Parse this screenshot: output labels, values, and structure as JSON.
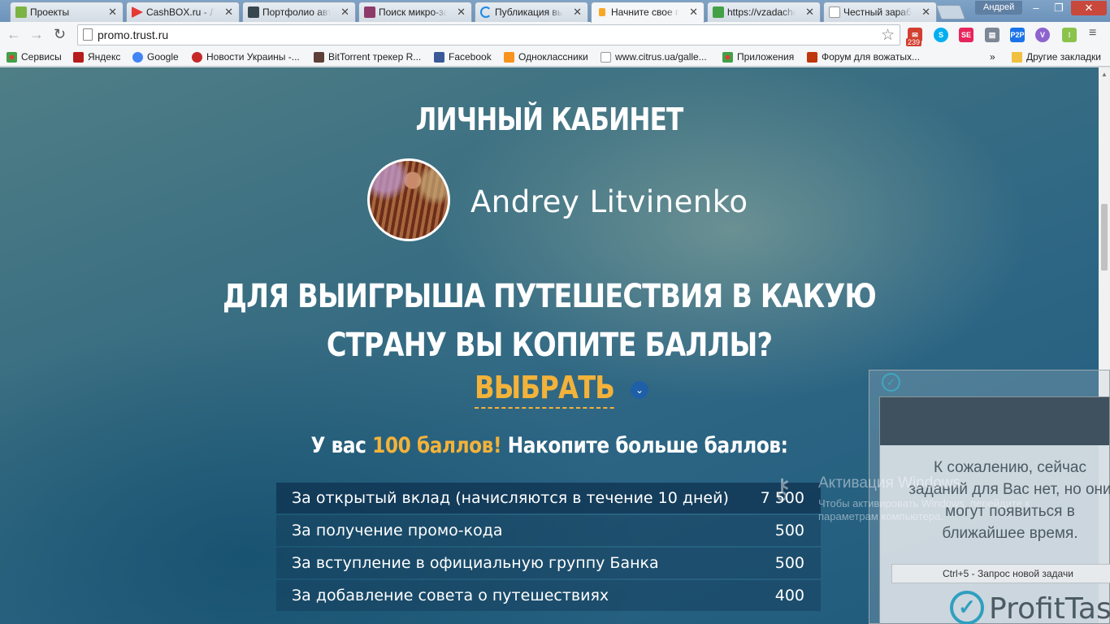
{
  "tabs": [
    {
      "title": "Проекты",
      "favicon_color": "#7cb342"
    },
    {
      "title": "CashBOX.ru - Ли",
      "favicon_color": "#e53935"
    },
    {
      "title": "Портфолио авто",
      "favicon_color": "#37474f"
    },
    {
      "title": "Поиск микро-за",
      "favicon_color": "#8e3b6b"
    },
    {
      "title": "Публикация вы",
      "favicon_color": "#1e88e5"
    },
    {
      "title": "Начните свое пу",
      "favicon_color": "#f9a825",
      "active": true
    },
    {
      "title": "https://vzadache",
      "favicon_color": "#43a047"
    },
    {
      "title": "Честный зараб",
      "favicon_color": "#ffffff"
    }
  ],
  "window": {
    "user_label": "Андрей",
    "minimize": "–",
    "maximize": "❐",
    "close": "✕"
  },
  "toolbar": {
    "url": "promo.trust.ru",
    "mail_badge": "239"
  },
  "bookmarks": [
    {
      "label": "Сервисы",
      "icon_color": "#e53935"
    },
    {
      "label": "Яндекс",
      "icon_color": "#b71c1c"
    },
    {
      "label": "Google",
      "icon_color": "#4285f4"
    },
    {
      "label": "Новости Украины -...",
      "icon_color": "#c62828"
    },
    {
      "label": "BitTorrent трекер R...",
      "icon_color": "#5d4037"
    },
    {
      "label": "Facebook",
      "icon_color": "#3b5998"
    },
    {
      "label": "Одноклассники",
      "icon_color": "#f7931e"
    },
    {
      "label": "www.citrus.ua/galle...",
      "icon_color": "#ffffff"
    },
    {
      "label": "Приложения",
      "icon_color": "#e53935"
    },
    {
      "label": "Форум для вожатых...",
      "icon_color": "#bf360c"
    }
  ],
  "bookmarks_overflow": "»",
  "other_bookmarks": "Другие закладки",
  "page": {
    "cabinet_title": "ЛИЧНЫЙ КАБИНЕТ",
    "user_name": "Andrey Litvinenko",
    "question_line1": "ДЛЯ ВЫИГРЫША ПУТЕШЕСТВИЯ В КАКУЮ",
    "question_line2": "СТРАНУ ВЫ КОПИТЕ БАЛЛЫ?",
    "choose_label": "ВЫБРАТЬ",
    "points_prefix": "У вас ",
    "points_value": "100 баллов!",
    "points_suffix": " Накопите больше баллов:",
    "tasks": [
      {
        "label": "За открытый вклад (начисляются в течение 10 дней)",
        "points": "7 500"
      },
      {
        "label": "За получение промо-кода",
        "points": "500"
      },
      {
        "label": "За вступление в официальную группу Банка",
        "points": "500"
      },
      {
        "label": "За добавление совета о путешествиях",
        "points": "400"
      }
    ]
  },
  "activation": {
    "line1": "Активация Windows",
    "line2": "Чтобы активировать Windows, перейдите к",
    "line3": "параметрам компьютера."
  },
  "profittask": {
    "message_line1": "К сожалению, сейчас",
    "message_line2": "заданий для Вас нет, но они",
    "message_line3": "могут появиться в",
    "message_line4": "ближайшее время.",
    "hotkey": "Ctrl+5 - Запрос новой задачи",
    "logo_text": "ProfitTask"
  }
}
